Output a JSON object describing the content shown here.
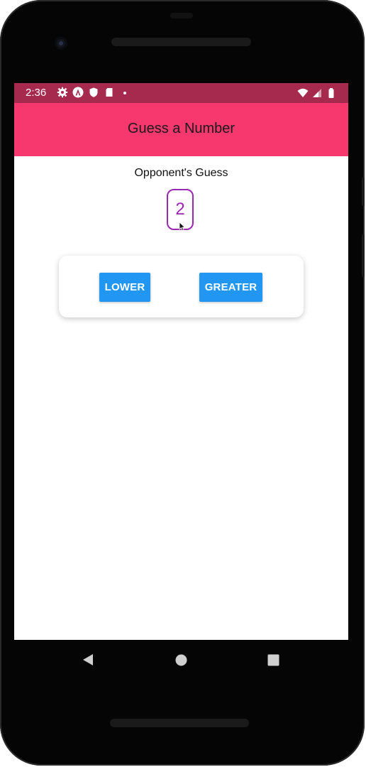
{
  "status_bar": {
    "time": "2:36",
    "color": "#a52a4e",
    "left_icons": [
      "gear-icon",
      "a-icon",
      "shield-icon",
      "sd-card-icon",
      "dot-icon"
    ],
    "right_icons": [
      "wifi-icon",
      "signal-icon",
      "battery-icon"
    ]
  },
  "header": {
    "title": "Guess a Number",
    "color": "#f7386e"
  },
  "game": {
    "subtitle": "Opponent's Guess",
    "guess": "2",
    "guess_color": "#9c27b0"
  },
  "buttons": {
    "lower_label": "LOWER",
    "greater_label": "GREATER",
    "color": "#2196f3"
  },
  "nav": {
    "icons": [
      "back-icon",
      "home-icon",
      "recents-icon"
    ]
  }
}
